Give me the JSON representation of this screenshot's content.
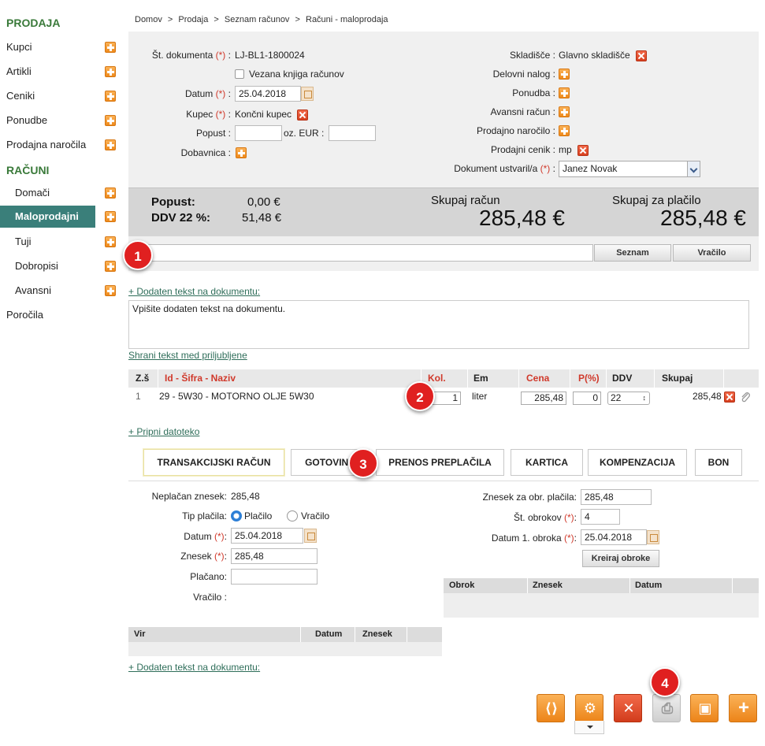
{
  "sidebar": {
    "section1": "PRODAJA",
    "items1": [
      {
        "label": "Kupci"
      },
      {
        "label": "Artikli"
      },
      {
        "label": "Ceniki"
      },
      {
        "label": "Ponudbe"
      },
      {
        "label": "Prodajna naročila"
      }
    ],
    "section2": "RAČUNI",
    "items2": [
      {
        "label": "Domači"
      },
      {
        "label": "Maloprodajni"
      },
      {
        "label": "Tuji"
      },
      {
        "label": "Dobropisi"
      },
      {
        "label": "Avansni"
      }
    ],
    "reports": "Poročila"
  },
  "breadcrumb": [
    "Domov",
    ">",
    "Prodaja",
    ">",
    "Seznam računov",
    ">",
    "Računi - maloprodaja"
  ],
  "form": {
    "doc_number_label": "Št. dokumenta",
    "doc_number": "LJ-BL1-1800024",
    "linked_book_label": "Vezana knjiga računov",
    "date_label": "Datum",
    "date": "25.04.2018",
    "customer_label": "Kupec",
    "customer": "Končni kupec",
    "discount_label": "Popust :",
    "or_eur_label": "oz. EUR :",
    "delivery_label": "Dobavnica :",
    "required_mark": "(*)",
    "colon": ":",
    "warehouse_label": "Skladišče :",
    "warehouse": "Glavno skladišče",
    "work_order_label": "Delovni nalog :",
    "offer_label": "Ponudba :",
    "advance_label": "Avansni račun :",
    "sales_order_label": "Prodajno naročilo :",
    "price_list_label": "Prodajni cenik :",
    "price_list": "mp",
    "created_by_label": "Dokument ustvaril/a",
    "created_by": "Janez Novak"
  },
  "totals": {
    "discount_label": "Popust:",
    "discount": "0,00 €",
    "vat_label": "DDV 22 %:",
    "vat": "51,48 €",
    "invoice_total_label": "Skupaj račun",
    "invoice_total": "285,48 €",
    "to_pay_label": "Skupaj za plačilo",
    "to_pay": "285,48 €"
  },
  "search": {
    "list_button": "Seznam",
    "change_button": "Vračilo"
  },
  "markers": [
    "1",
    "2",
    "3",
    "4"
  ],
  "extra_text": {
    "link": "+ Dodaten tekst na dokumentu:",
    "value": "Vpišite dodaten tekst na dokumentu.",
    "save_link": "Shrani tekst med priljubljene"
  },
  "items": {
    "headers": {
      "no": "Z.š",
      "name": "Id - Šifra - Naziv",
      "qty": "Kol.",
      "unit": "Em",
      "price": "Cena",
      "pct": "P(%)",
      "vat": "DDV",
      "total": "Skupaj"
    },
    "rows": [
      {
        "no": "1",
        "name": "29 - 5W30 - MOTORNO OLJE 5W30",
        "qty": "1",
        "unit": "liter",
        "price": "285,48",
        "pct": "0",
        "vat": "22",
        "total": "285,48"
      }
    ]
  },
  "attach_link": "+ Pripni datoteko",
  "payment_tabs": [
    "TRANSAKCIJSKI RAČUN",
    "GOTOVINA",
    "PRENOS PREPLAČILA",
    "KARTICA",
    "KOMPENZACIJA",
    "BON"
  ],
  "payment": {
    "unpaid_label": "Neplačan znesek:",
    "unpaid": "285,48",
    "type_label": "Tip plačila:",
    "type_pay": "Plačilo",
    "type_refund": "Vračilo",
    "date_label": "Datum",
    "date": "25.04.2018",
    "amount_label": "Znesek",
    "amount": "285,48",
    "paid_label": "Plačano:",
    "change_label": "Vračilo :",
    "installment_amount_label": "Znesek za obr. plačila:",
    "installment_amount": "285,48",
    "installments_label": "Št. obrokov",
    "installments": "4",
    "first_installment_label": "Datum 1. obroka",
    "first_installment": "25.04.2018",
    "create_button": "Kreiraj obroke",
    "installment_grid": [
      "Obrok",
      "Znesek",
      "Datum"
    ],
    "source_grid": [
      "Vir",
      "Datum",
      "Znesek"
    ]
  },
  "footer_link": "+ Dodaten tekst na dokumentu:",
  "colors": {
    "accent_green": "#3a7f7a",
    "brand_orange": "#ef8a1c",
    "required_red": "#d0392b",
    "marker_red": "#e02020"
  }
}
